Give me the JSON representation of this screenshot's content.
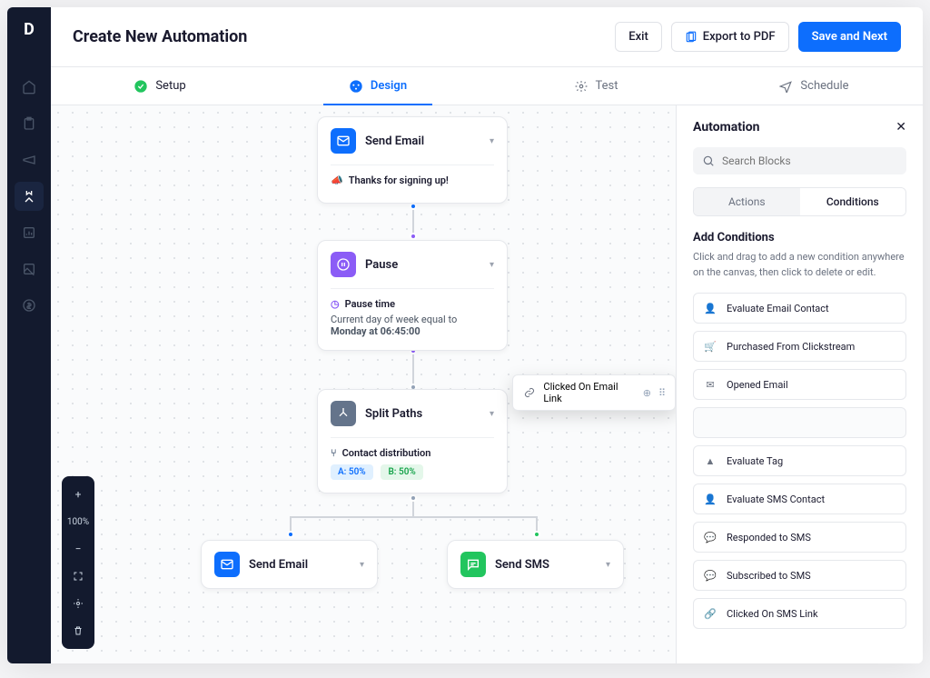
{
  "header": {
    "title": "Create New Automation",
    "exit": "Exit",
    "export": "Export to PDF",
    "save": "Save and Next"
  },
  "steps": {
    "setup": "Setup",
    "design": "Design",
    "test": "Test",
    "schedule": "Schedule"
  },
  "toolbar": {
    "zoom": "100%"
  },
  "nodes": {
    "email1": {
      "title": "Send Email",
      "subject_label": "Thanks for signing up!"
    },
    "pause": {
      "title": "Pause",
      "label": "Pause time",
      "desc_prefix": "Current day of week equal to ",
      "desc_value": "Monday at 06:45:00"
    },
    "split": {
      "title": "Split Paths",
      "label": "Contact distribution",
      "chip_a": "A: 50%",
      "chip_b": "B: 50%"
    },
    "email2": {
      "title": "Send Email"
    },
    "sms": {
      "title": "Send SMS"
    }
  },
  "panel": {
    "title": "Automation",
    "search_placeholder": "Search Blocks",
    "tab_actions": "Actions",
    "tab_conditions": "Conditions",
    "section_title": "Add Conditions",
    "section_desc": "Click and drag to add a new condition anywhere on the canvas, then click to delete or edit.",
    "items": [
      "Evaluate Email Contact",
      "Purchased From Clickstream",
      "Opened Email",
      "Evaluate Tag",
      "Evaluate SMS Contact",
      "Responded to SMS",
      "Subscribed to SMS",
      "Clicked On SMS Link"
    ],
    "dragging_item": "Clicked On Email Link"
  },
  "colors": {
    "blue": "#0d6efd",
    "purple": "#8b5cf6",
    "gray": "#64748b",
    "green": "#22c55e"
  }
}
